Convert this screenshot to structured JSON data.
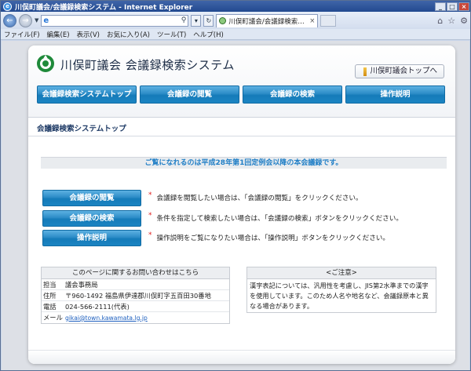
{
  "browser": {
    "window_title": "川俣町議会/会議録検索システム - Internet Explorer",
    "tab_title": "川俣町議会/会議録検索シ...",
    "menu": [
      "ファイル(F)",
      "編集(E)",
      "表示(V)",
      "お気に入り(A)",
      "ツール(T)",
      "ヘルプ(H)"
    ]
  },
  "site": {
    "title": "川俣町議会  会議録検索システム",
    "top_link": "川俣町議会トップへ",
    "nav": [
      "会議録検索システムトップ",
      "会議録の閲覧",
      "会議録の検索",
      "操作説明"
    ]
  },
  "main": {
    "section_title": "会議録検索システムトップ",
    "notice": "ご覧になれるのは平成28年第1回定例会以降の本会議録です。",
    "actions": [
      {
        "label": "会議録の閲覧",
        "mark": "*",
        "desc": "会議録を閲覧したい場合は、「会議録の閲覧」をクリックください。"
      },
      {
        "label": "会議録の検索",
        "mark": "*",
        "desc": "条件を指定して検索したい場合は、「会議録の検索」ボタンをクリックください。"
      },
      {
        "label": "操作説明",
        "mark": "*",
        "desc": "操作説明をご覧になりたい場合は、「操作説明」ボタンをクリックください。"
      }
    ]
  },
  "contact": {
    "heading": "このページに関するお問い合わせはこちら",
    "rows": [
      {
        "key": "担当",
        "value": "議会事務局"
      },
      {
        "key": "住所",
        "value": "〒960-1492 福島県伊達郡川俣町字五百田30番地"
      },
      {
        "key": "電話",
        "value": "024-566-2111(代表)"
      },
      {
        "key": "メール",
        "value": "gikai@town.kawamata.lg.jp"
      }
    ]
  },
  "caution": {
    "heading": "<ご注意>",
    "body": "漢字表記については、汎用性を考慮し、JIS第2水準までの漢字を使用しています。このため人名や地名など、会議録原本と異なる場合があります。"
  },
  "colors": {
    "button_blue": "#2c8cc7",
    "notice_blue": "#1f7ec6",
    "required_mark": "#e02020"
  }
}
